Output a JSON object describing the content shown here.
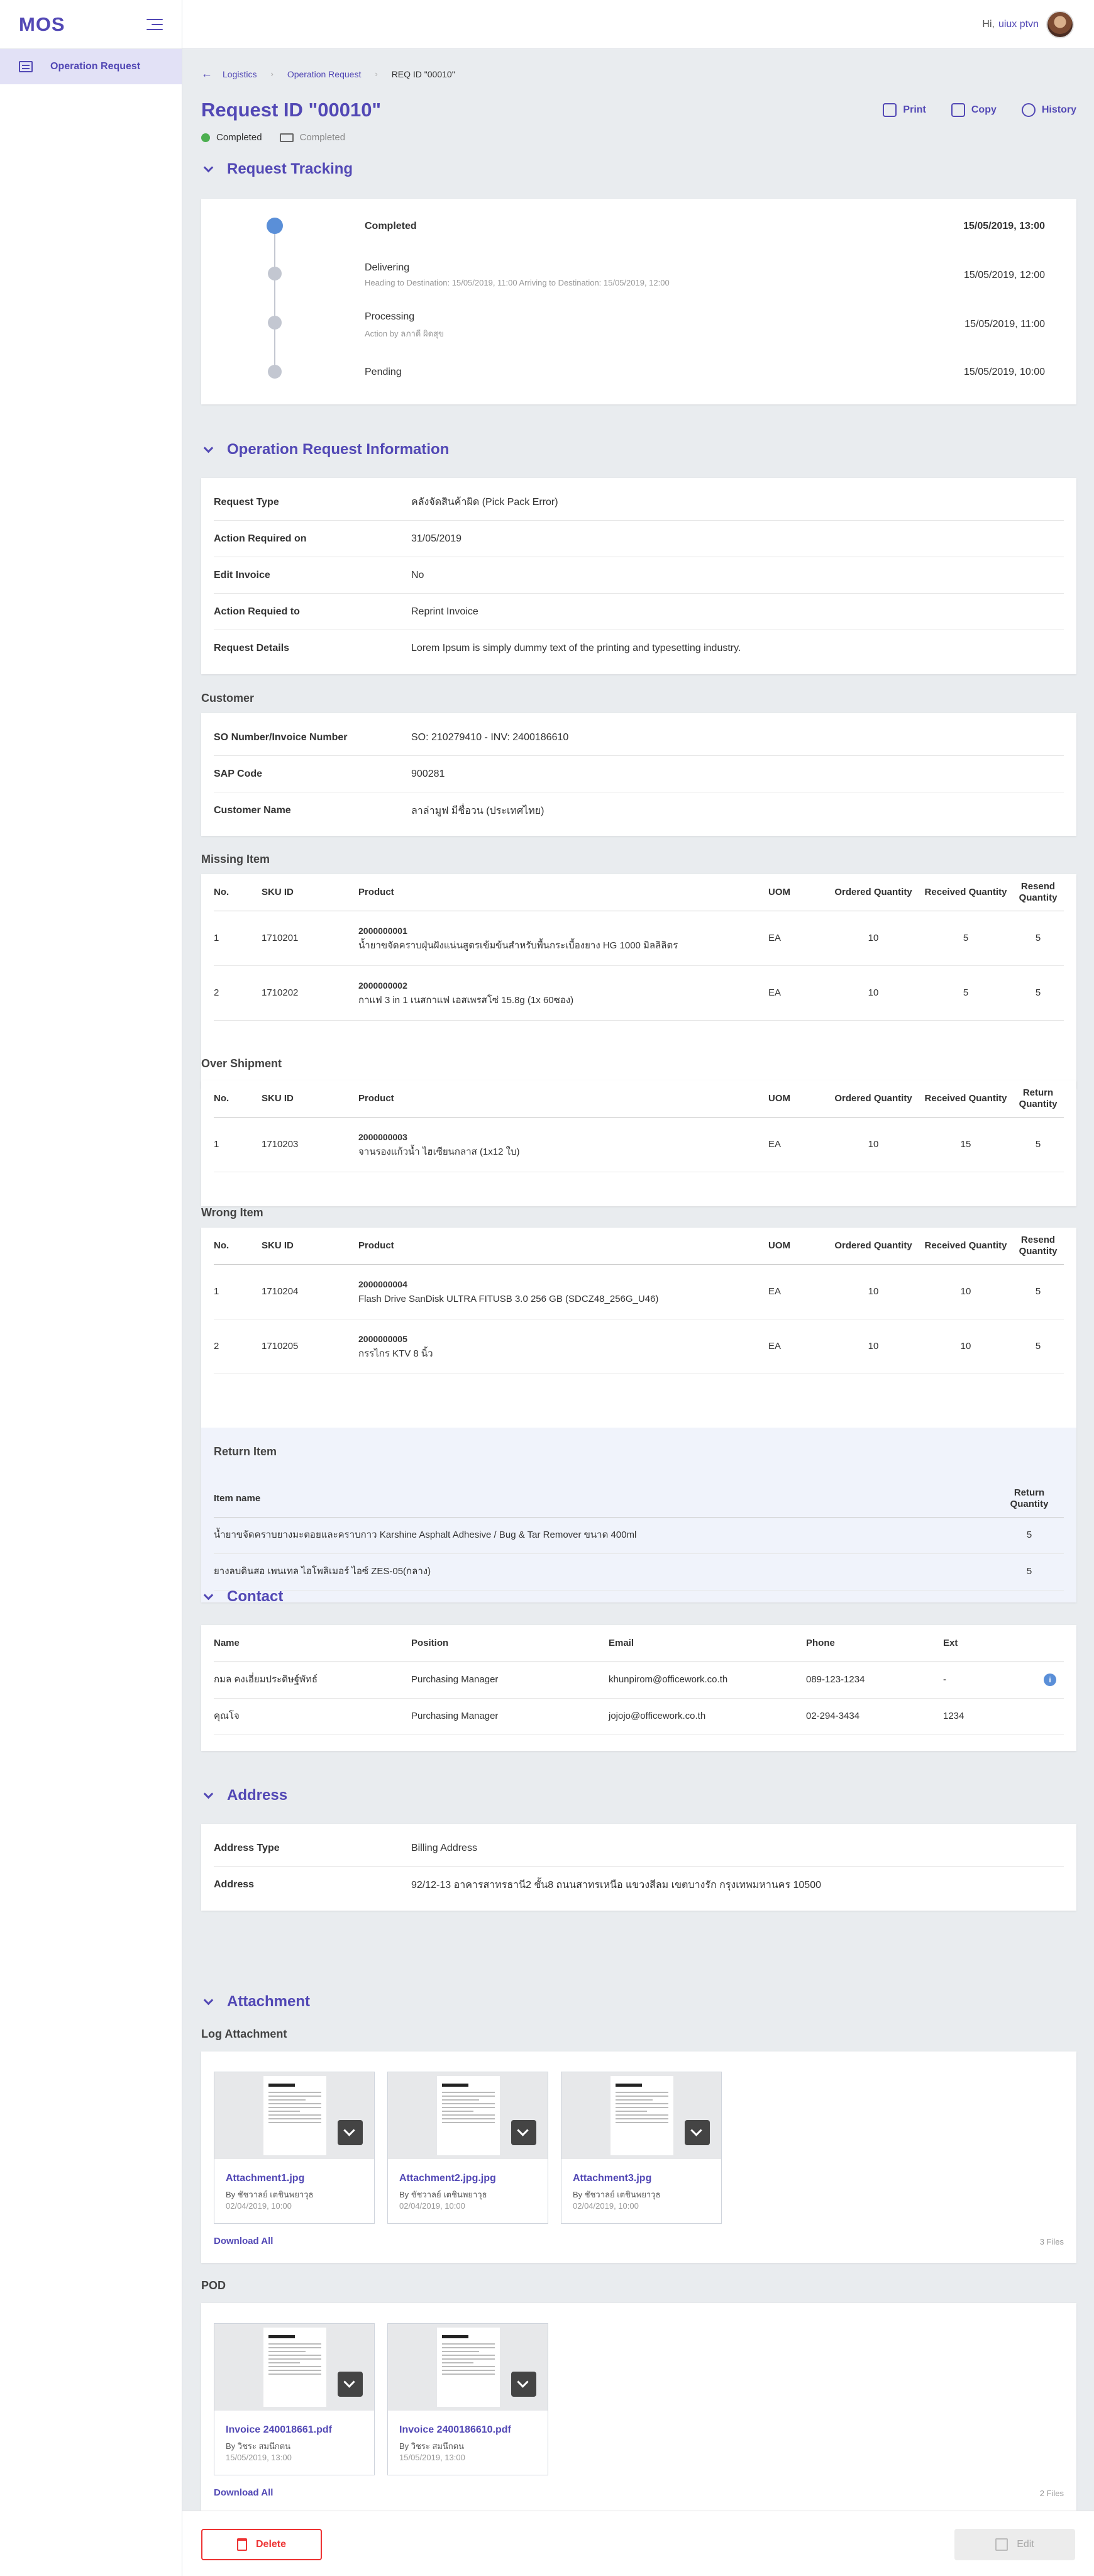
{
  "app": {
    "logo": "MOS"
  },
  "sidebar": {
    "items": [
      {
        "label": "Operation Request"
      }
    ]
  },
  "header": {
    "greeting": "Hi,",
    "username": "uiux ptvn"
  },
  "breadcrumb": [
    "Logistics",
    "Operation Request",
    "REQ ID \"00010\""
  ],
  "page": {
    "title": "Request ID \"00010\"",
    "status": "Completed",
    "delivery_status": "Completed"
  },
  "actions": {
    "print": "Print",
    "copy": "Copy",
    "history": "History"
  },
  "sections": {
    "tracking": "Request Tracking",
    "info": "Operation Request Information",
    "customer": "Customer",
    "missing": "Missing Item",
    "over": "Over Shipment",
    "wrong": "Wrong Item",
    "return": "Return Item",
    "contact": "Contact",
    "address": "Address",
    "attachment": "Attachment",
    "log_attachment": "Log Attachment",
    "pod": "POD"
  },
  "tracking": [
    {
      "name": "Completed",
      "desc": "",
      "date": "15/05/2019, 13:00"
    },
    {
      "name": "Delivering",
      "desc": "Heading to Destination: 15/05/2019, 11:00   Arriving to Destination: 15/05/2019, 12:00",
      "date": "15/05/2019, 12:00"
    },
    {
      "name": "Processing",
      "desc": "Action by ลภาดี ผิดสุข",
      "date": "15/05/2019, 11:00"
    },
    {
      "name": "Pending",
      "desc": "",
      "date": "15/05/2019, 10:00"
    }
  ],
  "info": [
    {
      "k": "Request Type",
      "v": "คลังจัดสินค้าผิด (Pick Pack Error)"
    },
    {
      "k": "Action Required on",
      "v": "31/05/2019"
    },
    {
      "k": "Edit Invoice",
      "v": "No"
    },
    {
      "k": "Action Requied to",
      "v": "Reprint Invoice"
    },
    {
      "k": "Request Details",
      "v": "Lorem Ipsum is simply dummy text of the printing and typesetting industry."
    }
  ],
  "customer": [
    {
      "k": "SO Number/Invoice Number",
      "v": "SO: 210279410 - INV: 2400186610"
    },
    {
      "k": "SAP Code",
      "v": "900281"
    },
    {
      "k": "Customer Name",
      "v": "ลาล่ามูฟ มีชื่อวน (ประเทศไทย)"
    }
  ],
  "table_headers": {
    "no": "No.",
    "sku": "SKU ID",
    "product": "Product",
    "uom": "UOM",
    "ordered": "Ordered Quantity",
    "received": "Received Quantity",
    "resend": "Resend Quantity",
    "return": "Return Quantity"
  },
  "missing_items": [
    {
      "no": "1",
      "sku": "1710201",
      "code": "2000000001",
      "name": "น้ำยาขจัดคราบฝุ่นฝังแน่นสูตรเข้มข้นสำหรับพื้นกระเบื้องยาง HG 1000 มิลลิลิตร",
      "uom": "EA",
      "ordered": "10",
      "received": "5",
      "q": "5"
    },
    {
      "no": "2",
      "sku": "1710202",
      "code": "2000000002",
      "name": "กาแฟ 3 in 1 เนสกาแฟ เอสเพรสโซ่ 15.8g (1x 60ซอง)",
      "uom": "EA",
      "ordered": "10",
      "received": "5",
      "q": "5"
    }
  ],
  "over_items": [
    {
      "no": "1",
      "sku": "1710203",
      "code": "2000000003",
      "name": "จานรองแก้วน้ำ ไฮเซียนกลาส (1x12 ใบ)",
      "uom": "EA",
      "ordered": "10",
      "received": "15",
      "q": "5"
    }
  ],
  "wrong_items": [
    {
      "no": "1",
      "sku": "1710204",
      "code": "2000000004",
      "name": "Flash Drive SanDisk ULTRA FITUSB 3.0 256 GB (SDCZ48_256G_U46)",
      "uom": "EA",
      "ordered": "10",
      "received": "10",
      "q": "5"
    },
    {
      "no": "2",
      "sku": "1710205",
      "code": "2000000005",
      "name": "กรรไกร KTV 8 นิ้ว",
      "uom": "EA",
      "ordered": "10",
      "received": "10",
      "q": "5"
    }
  ],
  "return_headers": {
    "name": "Item name",
    "q": "Return Quantity"
  },
  "return_items": [
    {
      "name": "น้ำยาขจัดคราบยางมะตอยและคราบกาว Karshine Asphalt Adhesive / Bug & Tar Remover ขนาด 400ml",
      "q": "5"
    },
    {
      "name": "ยางลบดินสอ เพนเทล ไฮโพลิเมอร์ ไอซ์ ZES-05(กลาง)",
      "q": "5"
    }
  ],
  "contact_headers": {
    "name": "Name",
    "position": "Position",
    "email": "Email",
    "phone": "Phone",
    "ext": "Ext"
  },
  "contacts": [
    {
      "name": "กมล คงเอี่ยมประดิษฐ์พัทธ์",
      "position": "Purchasing Manager",
      "email": "khunpirom@officework.co.th",
      "phone": "089-123-1234",
      "ext": "-"
    },
    {
      "name": "คุณโจ",
      "position": "Purchasing Manager",
      "email": "jojojo@officework.co.th",
      "phone": "02-294-3434",
      "ext": "1234"
    }
  ],
  "address": [
    {
      "k": "Address Type",
      "v": "Billing Address"
    },
    {
      "k": "Address",
      "v": "92/12-13 อาคารสาทรธานี2 ชั้น8 ถนนสาทรเหนือ แขวงสีลม เขตบางรัก กรุงเทพมหานคร 10500"
    }
  ],
  "log_attachments": [
    {
      "name": "Attachment1.jpg",
      "by": "By ชัชวาลย์ เตชินพยาวุธ",
      "date": "02/04/2019, 10:00"
    },
    {
      "name": "Attachment2.jpg.jpg",
      "by": "By ชัชวาลย์ เตชินพยาวุธ",
      "date": "02/04/2019, 10:00"
    },
    {
      "name": "Attachment3.jpg",
      "by": "By ชัชวาลย์ เตชินพยาวุธ",
      "date": "02/04/2019, 10:00"
    }
  ],
  "log_download_all": "Download All",
  "log_count": "3 Files",
  "pod_files": [
    {
      "name": "Invoice 240018661.pdf",
      "by": "By วิชระ สมนึกตน",
      "date": "15/05/2019, 13:00"
    },
    {
      "name": "Invoice 2400186610.pdf",
      "by": "By วิชระ สมนึกตน",
      "date": "15/05/2019, 13:00"
    }
  ],
  "pod_download_all": "Download All",
  "pod_count": "2 Files",
  "footer": {
    "delete": "Delete",
    "edit": "Edit"
  },
  "colors": {
    "primary": "#5248b5",
    "success": "#4caf50",
    "danger": "#ee3333"
  }
}
